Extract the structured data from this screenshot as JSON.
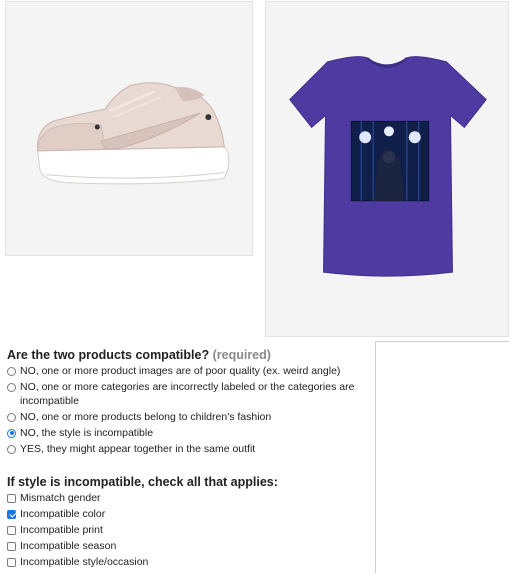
{
  "products": {
    "left": {
      "icon": "white-pink-platform-sneaker-image",
      "bg": "#f4f4f4"
    },
    "right": {
      "icon": "purple-tshirt-with-photo-print-image",
      "bg": "#f4f4f4",
      "shirt_color": "#4e3aa0"
    }
  },
  "q1": {
    "title": "Are the two products compatible?",
    "required": "(required)",
    "options": [
      {
        "label": "NO, one or more product images are of poor quality (ex. weird angle)",
        "selected": false
      },
      {
        "label": "NO, one or more categories are incorrectly labeled or the categories are incompatible",
        "selected": false
      },
      {
        "label": "NO, one or more products belong to children's fashion",
        "selected": false
      },
      {
        "label": "NO, the style is incompatible",
        "selected": true
      },
      {
        "label": "YES, they might appear together in the same outfit",
        "selected": false
      }
    ]
  },
  "q2": {
    "title": "If style is incompatible, check all that applies:",
    "options": [
      {
        "label": "Mismatch gender",
        "checked": false
      },
      {
        "label": "Incompatible color",
        "checked": true
      },
      {
        "label": "Incompatible print",
        "checked": false
      },
      {
        "label": "Incompatible season",
        "checked": false
      },
      {
        "label": "Incompatible style/occasion",
        "checked": false
      }
    ]
  },
  "colors": {
    "accent": "#1a73e8",
    "muted": "#8a8a8a"
  }
}
